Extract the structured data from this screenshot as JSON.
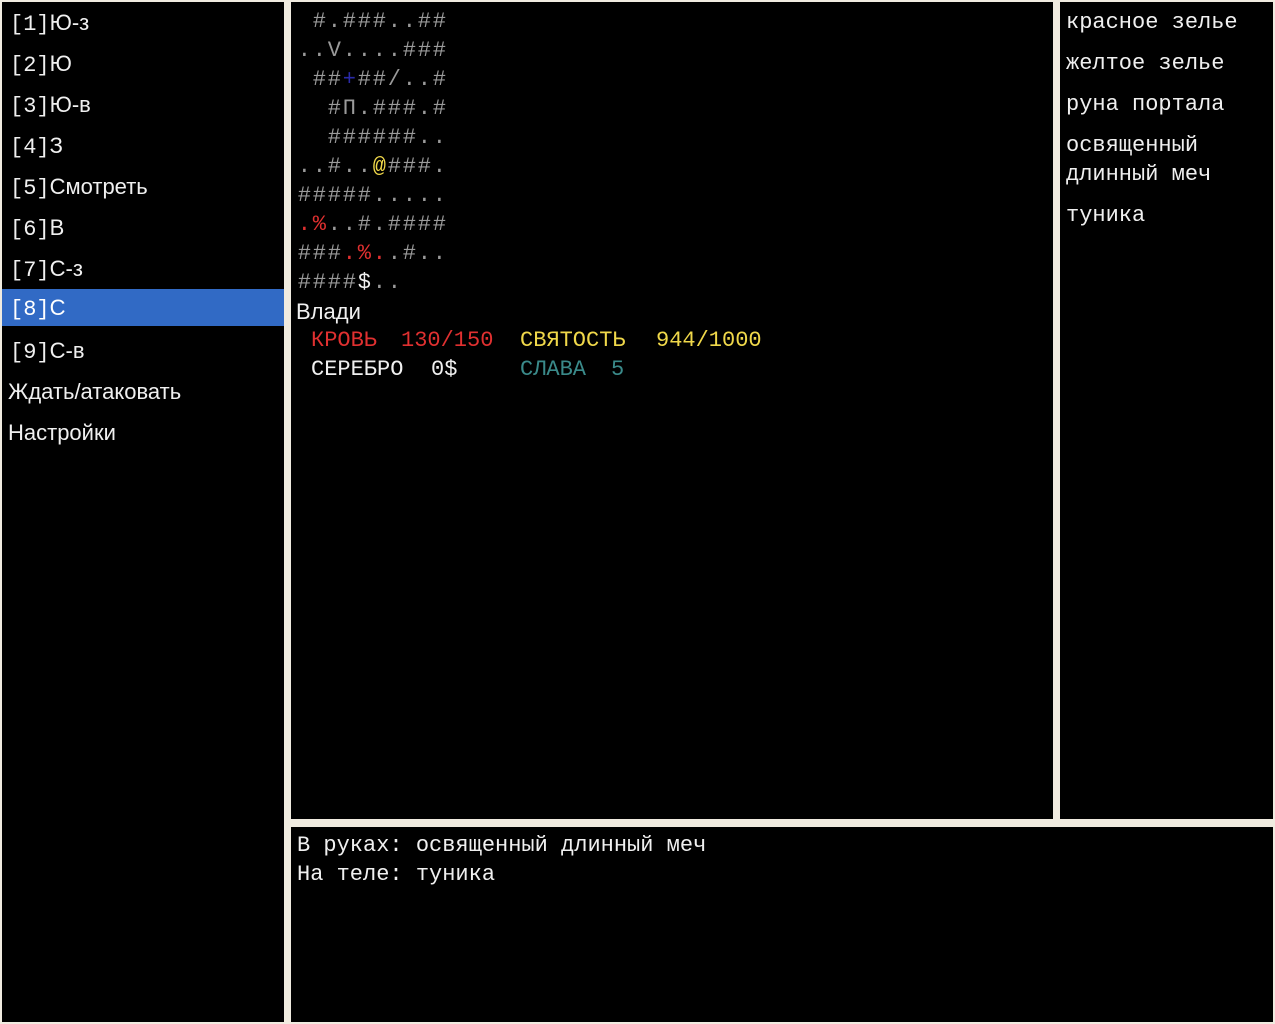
{
  "menu": {
    "items": [
      {
        "key": "[1]",
        "label": "Ю-з"
      },
      {
        "key": "[2]",
        "label": "Ю"
      },
      {
        "key": "[3]",
        "label": "Ю-в"
      },
      {
        "key": "[4]",
        "label": "З"
      },
      {
        "key": "[5]",
        "label": "Смотреть"
      },
      {
        "key": "[6]",
        "label": "В"
      },
      {
        "key": "[7]",
        "label": "С-з"
      },
      {
        "key": "[8]",
        "label": "С"
      },
      {
        "key": "[9]",
        "label": "С-в"
      }
    ],
    "wait_attack": "Ждать/атаковать",
    "settings": "Настройки",
    "selected_index": 7
  },
  "map": {
    "rows": [
      " #.###..##",
      "..V....###",
      " ##+##/..#",
      "  #П.###.#",
      "  ######..",
      "..#..@###.",
      "#####.....",
      ".%..#.####",
      "###.%..#..",
      "####$.."
    ]
  },
  "character": {
    "name": "Влади",
    "blood_label": "КРОВЬ",
    "blood": "130/150",
    "holiness_label": "СВЯТОСТЬ",
    "holiness": "944/1000",
    "silver_label": "СЕРЕБРО",
    "silver": "0$",
    "fame_label": "СЛАВА",
    "fame": "5"
  },
  "inventory": {
    "items": [
      "красное зелье",
      "желтое зелье",
      "руна портала",
      "освященный длинный меч",
      "туника"
    ]
  },
  "log": {
    "in_hands": "В руках: освященный длинный меч",
    "on_body": "На теле: туника"
  },
  "colors": {
    "selected_bg": "#316ac5",
    "blood": "#e03030",
    "holiness": "#f0d84a",
    "fame": "#3a8a8a",
    "wall": "#9a9a9a",
    "door": "#2a2aa8",
    "frame": "#f0ebe0"
  }
}
